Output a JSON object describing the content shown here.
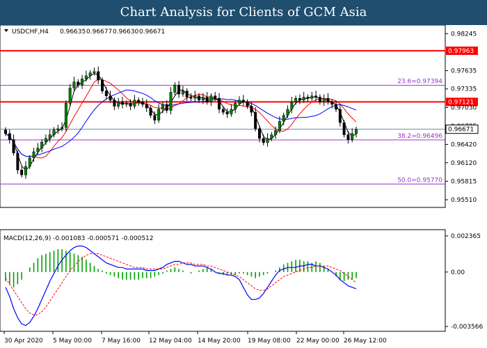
{
  "banner": {
    "title": "Chart Analysis for Clients of GCM Asia"
  },
  "chart_data": {
    "type": "candlestick",
    "header": {
      "symbol": "USDCHF,H4",
      "open": "0.96635",
      "high": "0.96677",
      "low": "0.96630",
      "close": "0.96671"
    },
    "price_axis": {
      "ticks": [
        "0.98245",
        "0.97635",
        "0.97335",
        "0.97030",
        "0.96725",
        "0.96420",
        "0.96120",
        "0.95815",
        "0.95510"
      ],
      "ylim": [
        0.9543,
        0.9834
      ]
    },
    "time_axis": {
      "ticks": [
        "30 Apr 2020",
        "5 May 00:00",
        "7 May 16:00",
        "12 May 04:00",
        "14 May 20:00",
        "19 May 08:00",
        "22 May 00:00",
        "26 May 12:00"
      ]
    },
    "resistance_levels": [
      {
        "label": "0.97963",
        "value": 0.97963,
        "color": "#ff0000"
      },
      {
        "label": "0.97121",
        "value": 0.97121,
        "color": "#ff0000"
      }
    ],
    "fibonacci_levels": [
      {
        "label": "23.6=0.97394",
        "value": 0.97394
      },
      {
        "label": "38.2=0.96496",
        "value": 0.96496
      },
      {
        "label": "50.0=0.95770",
        "value": 0.9577
      }
    ],
    "current_price": {
      "label": "0.96671",
      "value": 0.96671
    },
    "closes": [
      0.966,
      0.965,
      0.9628,
      0.96,
      0.9592,
      0.9606,
      0.962,
      0.963,
      0.9636,
      0.9646,
      0.9652,
      0.9658,
      0.9666,
      0.9668,
      0.967,
      0.971,
      0.9735,
      0.9745,
      0.974,
      0.975,
      0.9755,
      0.976,
      0.9762,
      0.9748,
      0.973,
      0.9722,
      0.9715,
      0.9705,
      0.9712,
      0.9708,
      0.971,
      0.9705,
      0.9715,
      0.9712,
      0.9708,
      0.9702,
      0.969,
      0.9682,
      0.97,
      0.9708,
      0.9698,
      0.9728,
      0.974,
      0.9725,
      0.973,
      0.972,
      0.9718,
      0.9722,
      0.9715,
      0.972,
      0.9712,
      0.9722,
      0.9718,
      0.97,
      0.9695,
      0.9692,
      0.97,
      0.971,
      0.9715,
      0.9712,
      0.9705,
      0.9695,
      0.9668,
      0.9652,
      0.9645,
      0.9652,
      0.9658,
      0.9665,
      0.968,
      0.969,
      0.97,
      0.9712,
      0.9718,
      0.9715,
      0.972,
      0.9718,
      0.9722,
      0.972,
      0.9712,
      0.9718,
      0.9712,
      0.9708,
      0.97,
      0.9678,
      0.9658,
      0.965,
      0.966,
      0.9667
    ],
    "macd": {
      "label": "MACD(12,26,9) -0.001083 -0.000571 -0.000512",
      "ticks": [
        "0.002365",
        "0.00",
        "-0.003566"
      ],
      "ylim": [
        -0.0037,
        0.0025
      ],
      "histogram": [
        -0.0006,
        -0.0008,
        -0.001,
        -0.0008,
        -0.0005,
        0.0,
        0.0003,
        0.0006,
        0.0009,
        0.0011,
        0.0012,
        0.0013,
        0.0014,
        0.0015,
        0.0015,
        0.0014,
        0.0013,
        0.0012,
        0.0011,
        0.001,
        0.0008,
        0.0006,
        0.0004,
        0.0002,
        0.0001,
        -0.0001,
        -0.0002,
        -0.0003,
        -0.0004,
        -0.0005,
        -0.0005,
        -0.0005,
        -0.0005,
        -0.0005,
        -0.0004,
        -0.0004,
        -0.0004,
        -0.0003,
        -0.0002,
        -0.0001,
        0.0001,
        0.0002,
        0.0003,
        0.0002,
        0.0001,
        0.0,
        -0.0001,
        0.0,
        0.0001,
        0.0002,
        0.0003,
        0.0002,
        0.0,
        -0.0001,
        -0.0002,
        -0.0002,
        -0.0002,
        -0.0002,
        -0.0001,
        -0.0001,
        -0.0002,
        -0.0003,
        -0.0004,
        -0.0003,
        -0.0002,
        -0.0001,
        0.0,
        0.0001,
        0.0003,
        0.0005,
        0.0006,
        0.0007,
        0.0008,
        0.0008,
        0.0007,
        0.0007,
        0.0006,
        0.0007,
        0.0006,
        0.0004,
        0.0002,
        0.0,
        -0.0003,
        -0.0005,
        -0.0006,
        -0.0005,
        -0.0005,
        -0.0004
      ],
      "macd_line": [
        -0.001,
        -0.0016,
        -0.0024,
        -0.003,
        -0.0034,
        -0.0035,
        -0.0033,
        -0.0029,
        -0.0024,
        -0.0018,
        -0.0012,
        -0.0006,
        -0.0001,
        0.0004,
        0.0008,
        0.0011,
        0.0014,
        0.0016,
        0.0017,
        0.0017,
        0.0016,
        0.0014,
        0.0012,
        0.001,
        0.0008,
        0.0006,
        0.0005,
        0.0004,
        0.0003,
        0.0003,
        0.0002,
        0.0002,
        0.0002,
        0.0002,
        0.0002,
        0.0001,
        0.0001,
        0.0001,
        0.0002,
        0.0003,
        0.0005,
        0.0006,
        0.0007,
        0.0007,
        0.0006,
        0.0005,
        0.0005,
        0.0004,
        0.0004,
        0.0004,
        0.0003,
        0.0002,
        0.0,
        -0.0001,
        -0.0001,
        -0.0002,
        -0.0002,
        -0.0003,
        -0.0005,
        -0.001,
        -0.0015,
        -0.0018,
        -0.0018,
        -0.0017,
        -0.0014,
        -0.001,
        -0.0006,
        -0.0002,
        0.0001,
        0.0002,
        0.0003,
        0.0003,
        0.0003,
        0.0004,
        0.0004,
        0.0005,
        0.0005,
        0.0004,
        0.0004,
        0.0003,
        0.0002,
        0.0,
        -0.0002,
        -0.0005,
        -0.0007,
        -0.0009,
        -0.001,
        -0.0011
      ],
      "signal_line": [
        -0.0004,
        -0.0008,
        -0.0012,
        -0.0016,
        -0.002,
        -0.0024,
        -0.0027,
        -0.0028,
        -0.0028,
        -0.0026,
        -0.0023,
        -0.0019,
        -0.0015,
        -0.0011,
        -0.0007,
        -0.0003,
        0.0001,
        0.0004,
        0.0007,
        0.0009,
        0.0011,
        0.0012,
        0.0012,
        0.0012,
        0.0011,
        0.001,
        0.0009,
        0.0008,
        0.0007,
        0.0006,
        0.0005,
        0.0004,
        0.0003,
        0.0003,
        0.0003,
        0.0002,
        0.0002,
        0.0002,
        0.0002,
        0.0002,
        0.0003,
        0.0004,
        0.0005,
        0.0005,
        0.0006,
        0.0006,
        0.0006,
        0.0005,
        0.0005,
        0.0005,
        0.0004,
        0.0004,
        0.0003,
        0.0002,
        0.0001,
        0.0,
        -0.0001,
        -0.0002,
        -0.0003,
        -0.0005,
        -0.0007,
        -0.0009,
        -0.0011,
        -0.0012,
        -0.0012,
        -0.0011,
        -0.0009,
        -0.0007,
        -0.0005,
        -0.0003,
        -0.0002,
        -0.0001,
        0.0,
        0.0001,
        0.0002,
        0.0003,
        0.0003,
        0.0004,
        0.0004,
        0.0004,
        0.0004,
        0.0003,
        0.0002,
        0.0001,
        -0.0001,
        -0.0003,
        -0.0005,
        -0.0007
      ]
    },
    "colors": {
      "candle_up": "#008000",
      "candle_down": "#000000",
      "ma_fast": "#000000",
      "ma_mid": "#ff0000",
      "ma_slow": "#0000ff",
      "fib": "#9933cc",
      "histogram": "#00a000",
      "macd": "#0000ff",
      "signal": "#ff0000"
    }
  }
}
